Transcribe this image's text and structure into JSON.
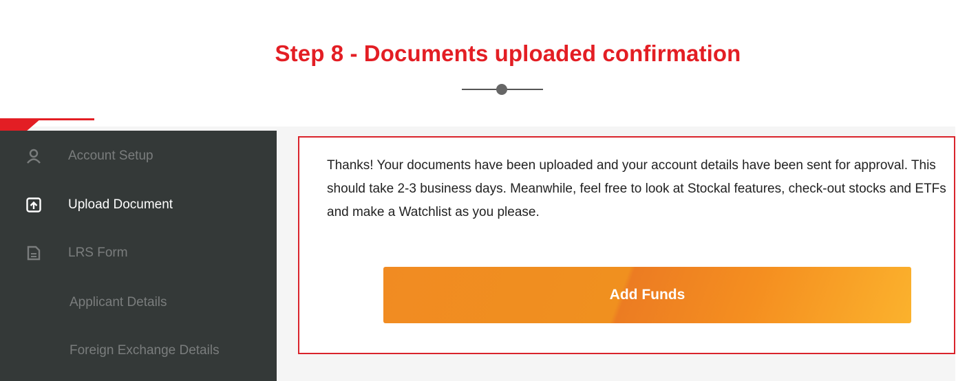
{
  "heading": {
    "title": "Step 8 - Documents uploaded confirmation"
  },
  "colors": {
    "accent_red": "#e31e24",
    "sidebar_bg": "#343938",
    "button_orange": "#f18b22",
    "button_yellow": "#fbb22d"
  },
  "sidebar": {
    "items": [
      {
        "label": "Account Setup",
        "icon": "user-icon",
        "active": false
      },
      {
        "label": "Upload Document",
        "icon": "upload-icon",
        "active": true
      },
      {
        "label": "LRS Form",
        "icon": "document-icon",
        "active": false
      },
      {
        "label": "Applicant Details",
        "icon": "",
        "active": false
      },
      {
        "label": "Foreign Exchange Details",
        "icon": "",
        "active": false
      }
    ]
  },
  "confirmation": {
    "message": "Thanks! Your documents have been uploaded and your account details have been sent for approval. This should take 2-3 business days. Meanwhile, feel free to look at Stockal features, check-out stocks and ETFs and make a Watchlist as you please.",
    "button_label": "Add Funds"
  }
}
